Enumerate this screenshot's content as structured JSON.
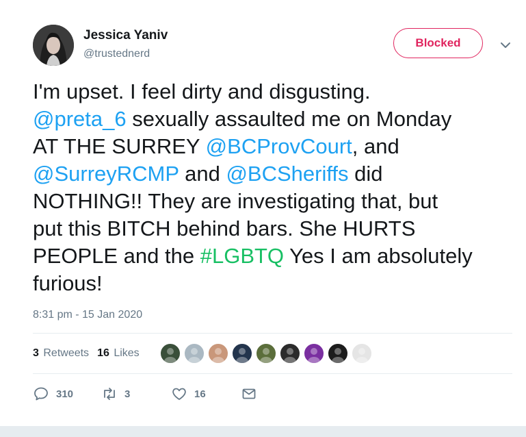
{
  "user": {
    "name": "Jessica Yaniv",
    "handle": "@trustednerd"
  },
  "header": {
    "blocked_label": "Blocked"
  },
  "tweet": {
    "segments": [
      {
        "text": "I'm upset. I feel dirty and disgusting.\n",
        "kind": "plain"
      },
      {
        "text": "@preta_6",
        "kind": "link"
      },
      {
        "text": " sexually assaulted me on Monday\nAT THE SURREY ",
        "kind": "plain"
      },
      {
        "text": "@BCProvCourt",
        "kind": "link"
      },
      {
        "text": ", and\n",
        "kind": "plain"
      },
      {
        "text": "@SurreyRCMP",
        "kind": "link"
      },
      {
        "text": " and ",
        "kind": "plain"
      },
      {
        "text": "@BCSheriffs",
        "kind": "link"
      },
      {
        "text": " did\nNOTHING!! They are investigating that, but\nput this BITCH behind bars. She HURTS\nPEOPLE and the ",
        "kind": "plain"
      },
      {
        "text": "#LGBTQ",
        "kind": "hashtag"
      },
      {
        "text": " Yes I am absolutely\nfurious!",
        "kind": "plain"
      }
    ],
    "timestamp": "8:31 pm - 15 Jan 2020"
  },
  "stats": {
    "retweets_count": "3",
    "retweets_label": "Retweets",
    "likes_count": "16",
    "likes_label": "Likes"
  },
  "likers": [
    {
      "icon": "liker-avatar-1",
      "color": "#3a4f3a"
    },
    {
      "icon": "liker-avatar-2",
      "color": "#aab8c2"
    },
    {
      "icon": "liker-avatar-3",
      "color": "#c9977a"
    },
    {
      "icon": "liker-avatar-4",
      "color": "#23354d"
    },
    {
      "icon": "liker-avatar-5",
      "color": "#5b6e3b"
    },
    {
      "icon": "liker-avatar-6",
      "color": "#2b2b2b"
    },
    {
      "icon": "liker-avatar-7",
      "color": "#7a2fa0"
    },
    {
      "icon": "liker-avatar-8",
      "color": "#1c1c1c"
    },
    {
      "icon": "liker-avatar-9",
      "color": "#e5e5e5"
    }
  ],
  "actions": {
    "reply_count": "310",
    "retweet_count": "3",
    "like_count": "16"
  },
  "colors": {
    "link": "#1da1f2",
    "hashtag": "#17bf63",
    "blocked": "#e0245e",
    "secondary": "#657786"
  }
}
